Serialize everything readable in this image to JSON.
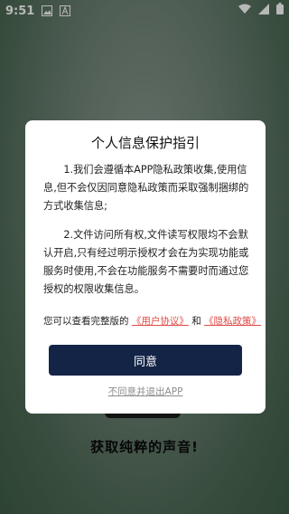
{
  "status_bar": {
    "time": "9:51",
    "icons_left": [
      "image-icon",
      "text-icon"
    ],
    "icons_right": [
      "wifi-icon",
      "signal-icon",
      "battery-icon"
    ]
  },
  "background": {
    "title": "获取纯粹的声音!"
  },
  "dialog": {
    "title": "个人信息保护指引",
    "paragraph1": "1.我们会遵循本APP隐私政策收集,使用信息,但不会仅因同意隐私政策而采取强制捆绑的方式收集信息;",
    "paragraph2": "2.文件访问所有权,文件读写权限均不会默认开启,只有经过明示授权才会在为实现功能或服务时使用,不会在功能服务不需要时而通过您授权的权限收集信息。",
    "view_prefix": "您可以查看完整版的",
    "user_agreement": "《用户协议》",
    "and": "和",
    "privacy_policy": "《隐私政策》",
    "agree_button": "同意",
    "exit_link": "不同意并退出APP"
  },
  "colors": {
    "agree_button": "#142446",
    "link": "#e04b47"
  }
}
